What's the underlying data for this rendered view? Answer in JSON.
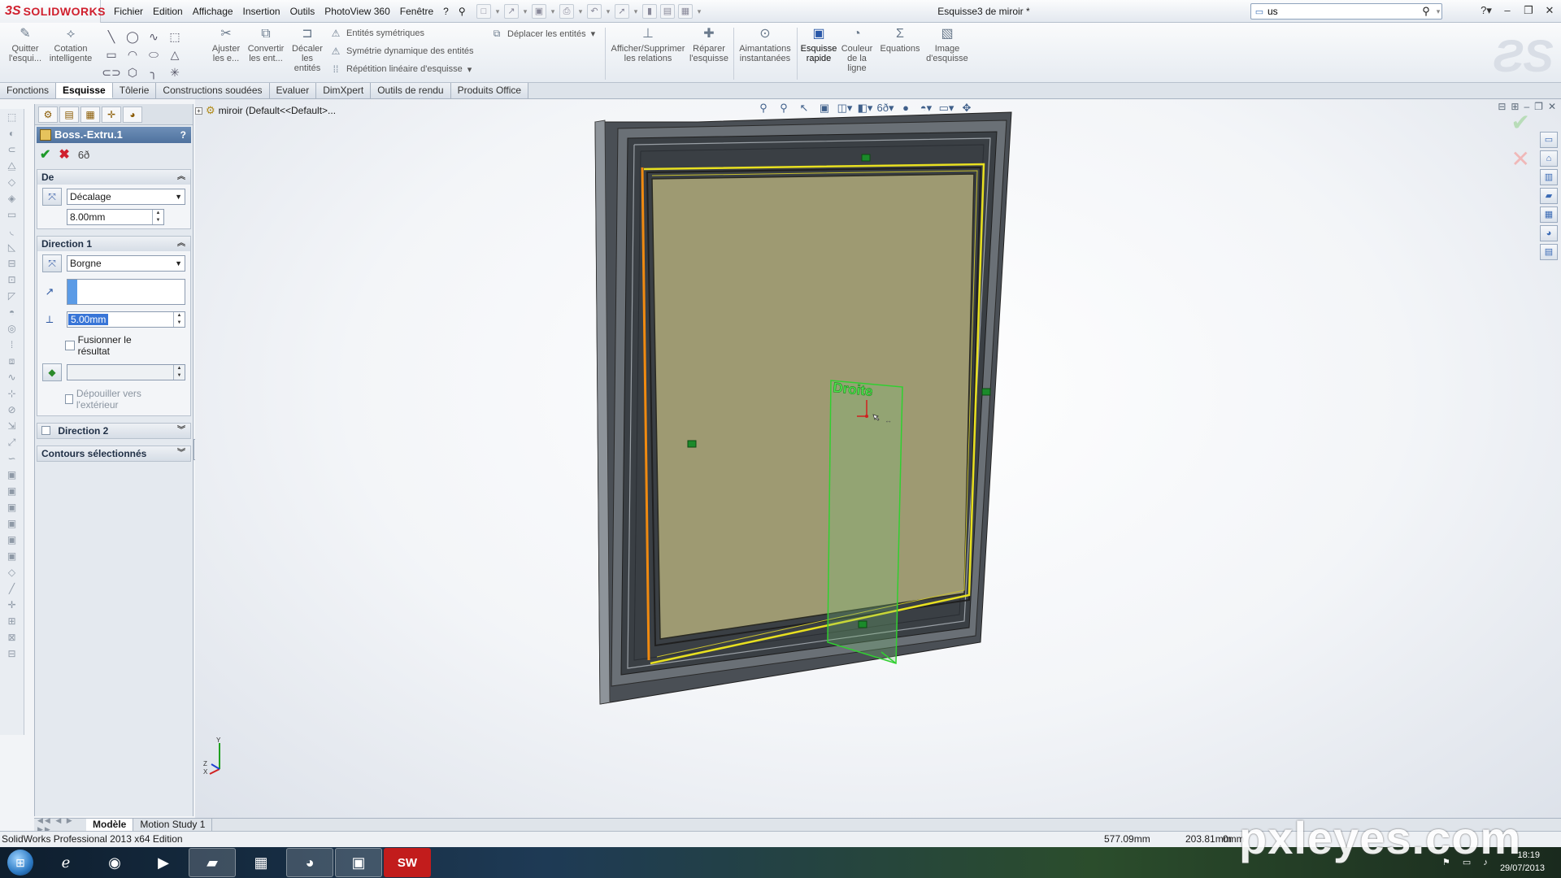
{
  "app": {
    "logo_ds": "3S",
    "logo_name": "SOLIDWORKS",
    "menus": [
      "Fichier",
      "Edition",
      "Affichage",
      "Insertion",
      "Outils",
      "PhotoView 360",
      "Fenêtre",
      "?"
    ],
    "document_title": "Esquisse3 de miroir *",
    "search_value": "us"
  },
  "ribbon": {
    "quitter": "Quitter l'esqui...",
    "cotation": "Cotation intelligente",
    "ajuster": "Ajuster les e...",
    "convertir": "Convertir les ent...",
    "decaler": "Décaler les entités",
    "entites_symetriques": "Entités symétriques",
    "symetrie_dynamique": "Symétrie dynamique des entités",
    "repetition": "Répétition linéaire d'esquisse",
    "deplacer": "Déplacer les entités",
    "afficher_relations": "Afficher/Supprimer les relations",
    "reparer": "Réparer l'esquisse",
    "aimantations": "Aimantations instantanées",
    "esquisse_rapide": "Esquisse rapide",
    "couleur_ligne": "Couleur de la ligne",
    "equations": "Equations",
    "image_esquisse": "Image d'esquisse"
  },
  "tabs": [
    "Fonctions",
    "Esquisse",
    "Tôlerie",
    "Constructions soudées",
    "Evaluer",
    "DimXpert",
    "Outils de rendu",
    "Produits Office"
  ],
  "property_manager": {
    "title": "Boss.-Extru.1",
    "help": "?",
    "de": {
      "header": "De",
      "type": "Décalage",
      "value": "8.00mm"
    },
    "direction1": {
      "header": "Direction 1",
      "type": "Borgne",
      "depth": "5.00mm",
      "merge_label": "Fusionner le résultat",
      "draft_label": "Dépouiller vers l'extérieur"
    },
    "direction2": {
      "header": "Direction 2"
    },
    "contours": {
      "header": "Contours sélectionnés"
    }
  },
  "viewport": {
    "tree_root": "miroir  (Default<<Default>...",
    "plane_label": "Droite"
  },
  "bottom_tabs": [
    "Modèle",
    "Motion Study 1"
  ],
  "status": {
    "edition": "SolidWorks Professional 2013 x64 Edition",
    "x": "577.09mm",
    "y": "203.81mm",
    "z": "0mm"
  },
  "taskbar": {
    "time": "18:19",
    "date": "29/07/2013"
  },
  "watermark": "pxleyes.com",
  "colors": {
    "accent_blue": "#4f729e",
    "ok_green": "#1e9a2a",
    "cancel_red": "#d0202e",
    "sketch_yellow": "#e8e020",
    "sketch_orange": "#f08a10",
    "plane_green": "#30d030"
  }
}
